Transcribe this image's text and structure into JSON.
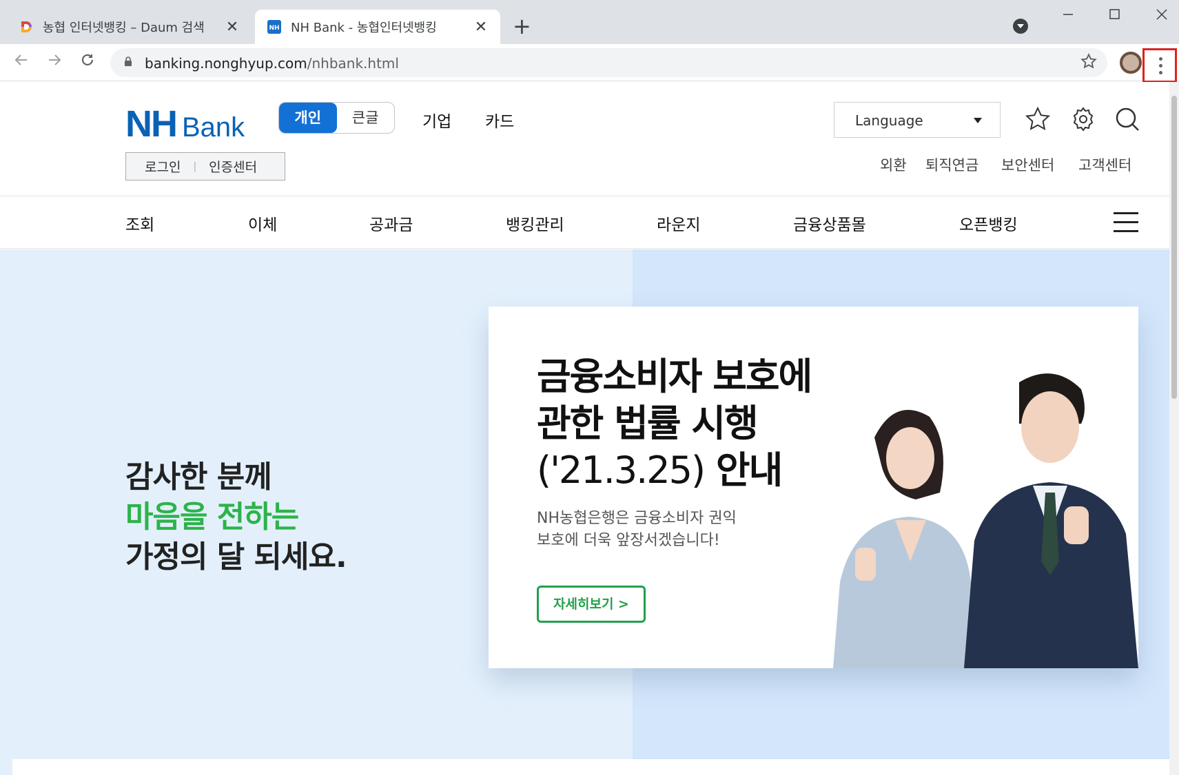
{
  "browser": {
    "tabs": [
      {
        "title": "농협 인터넷뱅킹 – Daum 검색",
        "favicon": "daum-icon",
        "active": false
      },
      {
        "title": "NH Bank - 농협인터넷뱅킹",
        "favicon": "nh-icon",
        "active": true
      }
    ],
    "close_glyph": "✕",
    "new_tab_glyph": "+",
    "url_host": "banking.nonghyup.com",
    "url_path": "/nhbank.html",
    "colors": {
      "menu_highlight": "#e0201f"
    }
  },
  "header": {
    "logo_nh": "NH",
    "logo_bank": "Bank",
    "mode_personal": "개인",
    "mode_large": "큰글",
    "nav_corporate": "기업",
    "nav_card": "카드",
    "language_label": "Language",
    "login": "로그인",
    "login_sep": "|",
    "cert_center": "인증센터",
    "util": [
      "외환",
      "퇴직연금",
      "보안센터",
      "고객센터"
    ]
  },
  "gnb": [
    "조회",
    "이체",
    "공과금",
    "뱅킹관리",
    "라운지",
    "금융상품몰",
    "오픈뱅킹"
  ],
  "hero": {
    "left_line1": "감사한 분께",
    "left_line2": "마음을 전하는",
    "left_line3": "가정의 달 되세요.",
    "card_line1": "금융소비자 보호에",
    "card_line2": "관한 법률 시행",
    "card_line3_date": "('21.3.25)",
    "card_line3_word": "안내",
    "card_sub1": "NH농협은행은 금융소비자 권익",
    "card_sub2": "보호에 더욱 앞장서겠습니다!",
    "detail_button": "자세히보기 >",
    "slide_count": 4,
    "active_slide": 1,
    "colors": {
      "accent_green": "#2db34a",
      "brand_blue": "#0a62b5"
    }
  }
}
